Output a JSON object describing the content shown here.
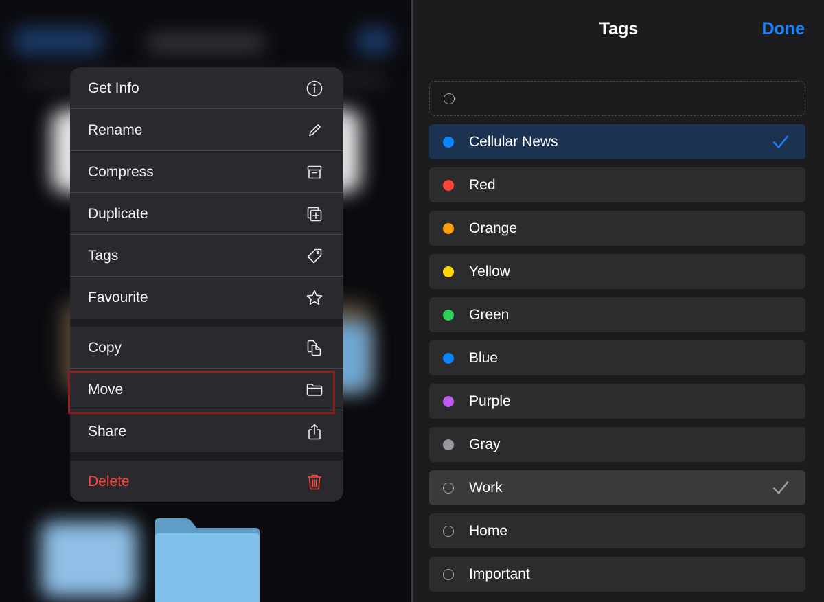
{
  "context_menu": {
    "items": [
      {
        "label": "Get Info",
        "icon": "info-icon"
      },
      {
        "label": "Rename",
        "icon": "pencil-icon"
      },
      {
        "label": "Compress",
        "icon": "archive-box-icon"
      },
      {
        "label": "Duplicate",
        "icon": "duplicate-icon"
      },
      {
        "label": "Tags",
        "icon": "tag-icon"
      },
      {
        "label": "Favourite",
        "icon": "star-icon"
      },
      {
        "label": "Copy",
        "icon": "copy-documents-icon"
      },
      {
        "label": "Move",
        "icon": "folder-icon",
        "highlighted": true
      },
      {
        "label": "Share",
        "icon": "share-icon"
      },
      {
        "label": "Delete",
        "icon": "trash-icon",
        "destructive": true
      }
    ]
  },
  "tags_panel": {
    "title": "Tags",
    "done_label": "Done",
    "new_tag_placeholder": "",
    "tags": [
      {
        "label": "Cellular News",
        "color": "#0a84ff",
        "checked": true,
        "selected": true
      },
      {
        "label": "Red",
        "color": "#ff453a",
        "checked": false
      },
      {
        "label": "Orange",
        "color": "#ff9f0a",
        "checked": false
      },
      {
        "label": "Yellow",
        "color": "#ffd60a",
        "checked": false
      },
      {
        "label": "Green",
        "color": "#30d158",
        "checked": false
      },
      {
        "label": "Blue",
        "color": "#0a84ff",
        "checked": false
      },
      {
        "label": "Purple",
        "color": "#bf5af2",
        "checked": false
      },
      {
        "label": "Gray",
        "color": "#98989d",
        "checked": false
      },
      {
        "label": "Work",
        "color": null,
        "checked": true,
        "selected": true
      },
      {
        "label": "Home",
        "color": null,
        "checked": false
      },
      {
        "label": "Important",
        "color": null,
        "checked": false
      }
    ]
  },
  "colors": {
    "accent": "#1a82ff",
    "destructive": "#ff453a",
    "highlight_box": "#8e1f1f"
  }
}
